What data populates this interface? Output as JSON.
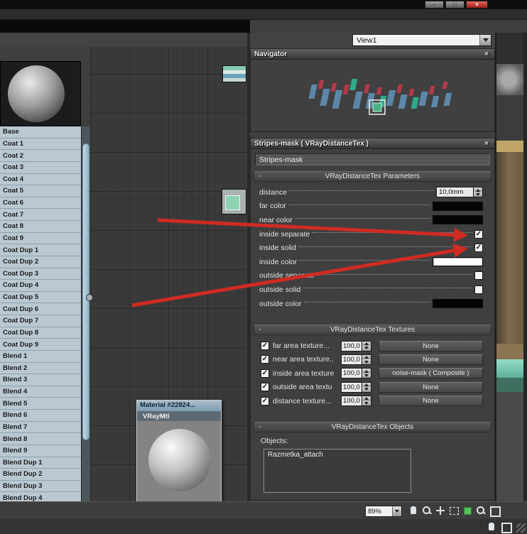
{
  "colors": {
    "arrow-red": "#cf2b22",
    "nav-red": "#b23a4a",
    "nav-blue": "#5d87a8",
    "nav-teal": "#2fa98c"
  },
  "icons": {
    "minimize": "–",
    "maximize": "□",
    "close": "×",
    "panel_close": "×",
    "check": "✓",
    "collapse": "-"
  },
  "window": {
    "view_selector": "View1"
  },
  "navigator": {
    "title": "Navigator"
  },
  "panel": {
    "title": "Stripes-mask  ( VRayDistanceTex )",
    "name_value": "Stripes-mask",
    "parameters": {
      "title": "VRayDistanceTex Parameters",
      "rows": [
        {
          "label": "distance",
          "value": "10,0mm"
        },
        {
          "label": "far color",
          "color": "#050505"
        },
        {
          "label": "near color",
          "color": "#050505"
        },
        {
          "label": "inside separate",
          "checked": true
        },
        {
          "label": "inside solid",
          "checked": true
        },
        {
          "label": "inside color",
          "color": "#ffffff"
        },
        {
          "label": "outside separate",
          "checked": false
        },
        {
          "label": "outside solid",
          "checked": false
        },
        {
          "label": "outside color",
          "color": "#050505"
        }
      ]
    },
    "textures": {
      "title": "VRayDistanceTex Textures",
      "rows": [
        {
          "label": "far area texture...",
          "amount": "100,0",
          "button": "None"
        },
        {
          "label": "near area texture..",
          "amount": "100,0",
          "button": "None"
        },
        {
          "label": "inside area texture",
          "amount": "100,0",
          "button": "noise-mask ( Composite )"
        },
        {
          "label": "outside area textu",
          "amount": "100,0",
          "button": "None"
        },
        {
          "label": "distance texture...",
          "amount": "100,0",
          "button": "None"
        }
      ]
    },
    "objects": {
      "title": "VRayDistanceTex Objects",
      "label": "Objects:",
      "items": [
        "Razmetka_attach"
      ]
    }
  },
  "slots": {
    "items": [
      "Base",
      "Coat 1",
      "Coat 2",
      "Coat 3",
      "Coat 4",
      "Coat 5",
      "Coat 6",
      "Coat 7",
      "Coat 8",
      "Coat 9",
      "Coat Dup 1",
      "Coat Dup 2",
      "Coat Dup 3",
      "Coat Dup 4",
      "Coat Dup 5",
      "Coat Dup 6",
      "Coat Dup 7",
      "Coat Dup 8",
      "Coat Dup 9",
      "Blend 1",
      "Blend 2",
      "Blend 3",
      "Blend 4",
      "Blend 5",
      "Blend 6",
      "Blend 7",
      "Blend 8",
      "Blend 9",
      "Blend Dup 1",
      "Blend Dup 2",
      "Blend Dup 3",
      "Blend Dup 4"
    ]
  },
  "node": {
    "title": "Material #22824...",
    "subtitle": "VRayMtl"
  },
  "statusbar": {
    "zoom": "89%"
  }
}
